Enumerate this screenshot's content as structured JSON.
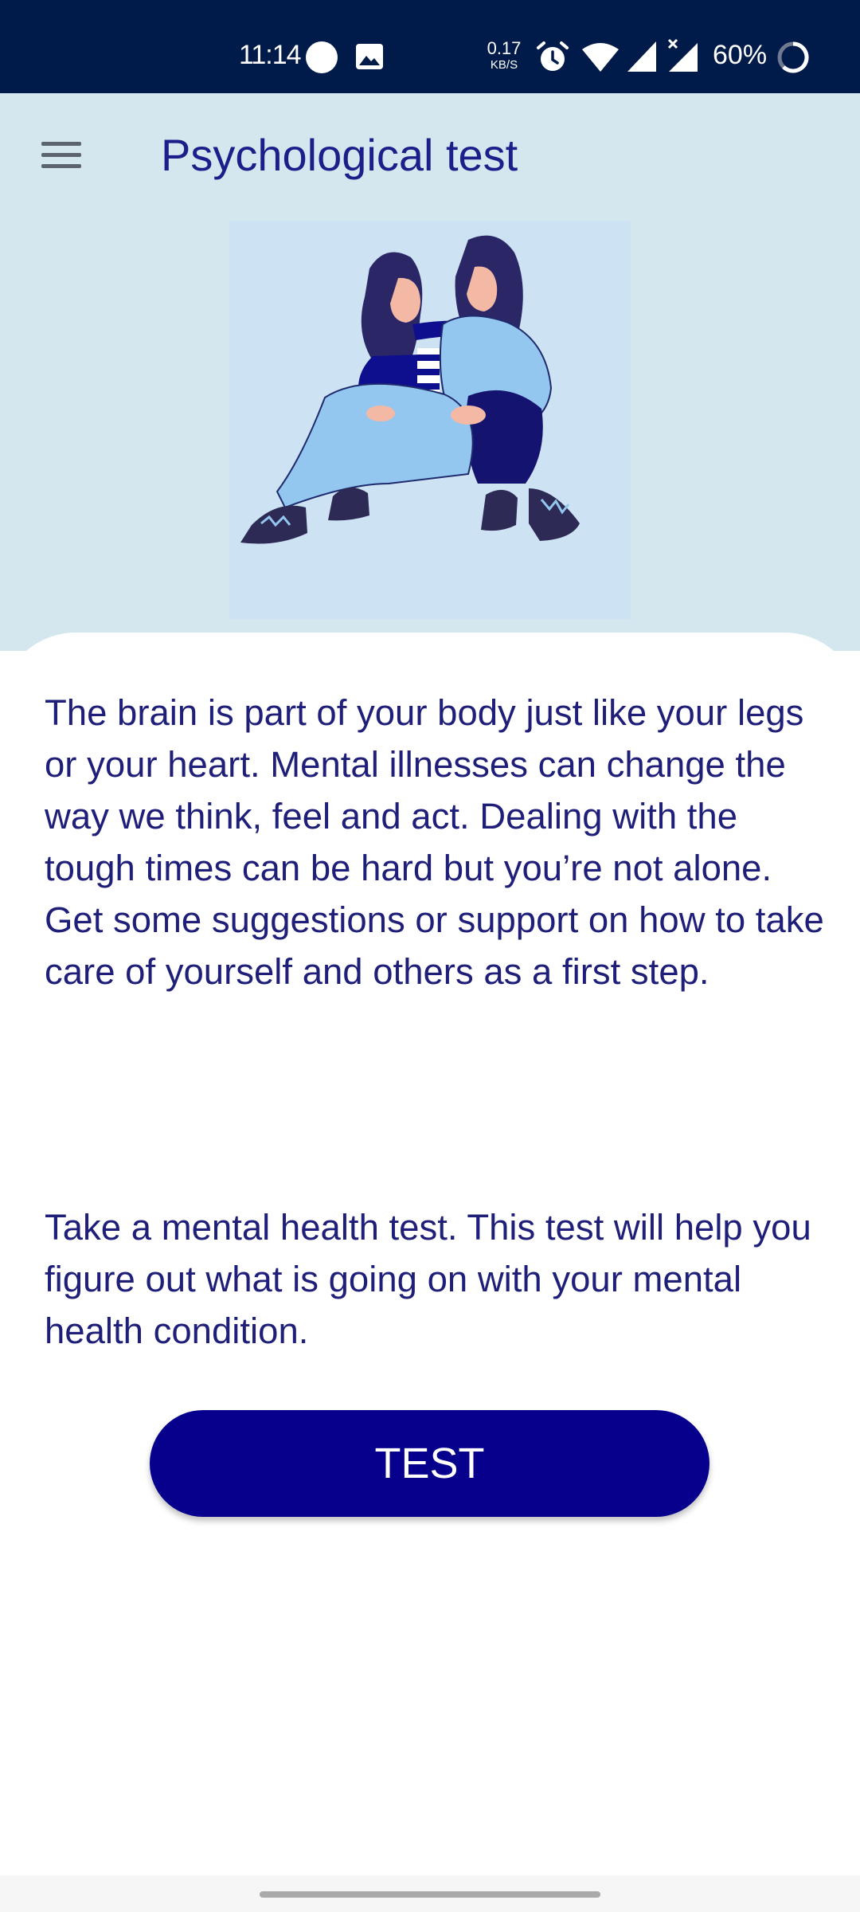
{
  "status_bar": {
    "time": "11:14",
    "net_speed_value": "0.17",
    "net_speed_unit": "KB/S",
    "battery": "60%",
    "icons": [
      "circle-notification-icon",
      "gallery-icon",
      "alarm-icon",
      "wifi-icon",
      "signal-icon",
      "signal-no-data-icon",
      "battery-icon"
    ]
  },
  "header": {
    "title": "Psychological test",
    "menu_icon": "hamburger-menu-icon"
  },
  "content": {
    "intro": "The brain is part of your body just like your legs or your heart. Mental illnesses can change the way we think, feel and act. Dealing with the tough times can be hard but you’re not alone. Get some suggestions or support on how to take care of yourself and others as a first step.",
    "test_prompt": "Take a mental health test. This test will help you figure out what is going on with your mental health condition.",
    "test_button_label": "TEST"
  },
  "colors": {
    "status_bar": "#001a4a",
    "header_background": "#d4e6ee",
    "title_text": "#1a1f8a",
    "body_text": "#1f1f7a",
    "button_background": "#07008d",
    "button_text": "#ffffff"
  }
}
